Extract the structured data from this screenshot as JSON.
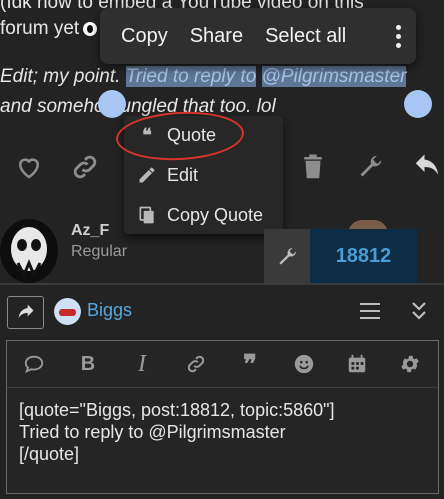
{
  "post": {
    "line1": "(Idk how to embed a YouTube video on this",
    "line2": "forum yet",
    "line3_prefix": "Edit; my point.",
    "line3_sel_a": "Tried to reply to",
    "line3_sel_b": "@Pilgrimsmaster",
    "line4": "and someho bungled that too. lol"
  },
  "selection_toolbar": {
    "copy": "Copy",
    "share": "Share",
    "select_all": "Select all"
  },
  "quote_menu": {
    "quote": "Quote",
    "edit": "Edit",
    "copy_quote": "Copy Quote"
  },
  "user": {
    "name": "Az_F",
    "role": "Regular",
    "post_number": "18812"
  },
  "composer": {
    "reply_to": "Biggs",
    "text": "[quote=\"Biggs, post:18812, topic:5860\"]\nTried to reply to @Pilgrimsmaster\n[/quote]"
  },
  "colors": {
    "accent_link": "#5aa6e0",
    "selection": "#5f7696",
    "annotation_circle": "#d7332d"
  }
}
